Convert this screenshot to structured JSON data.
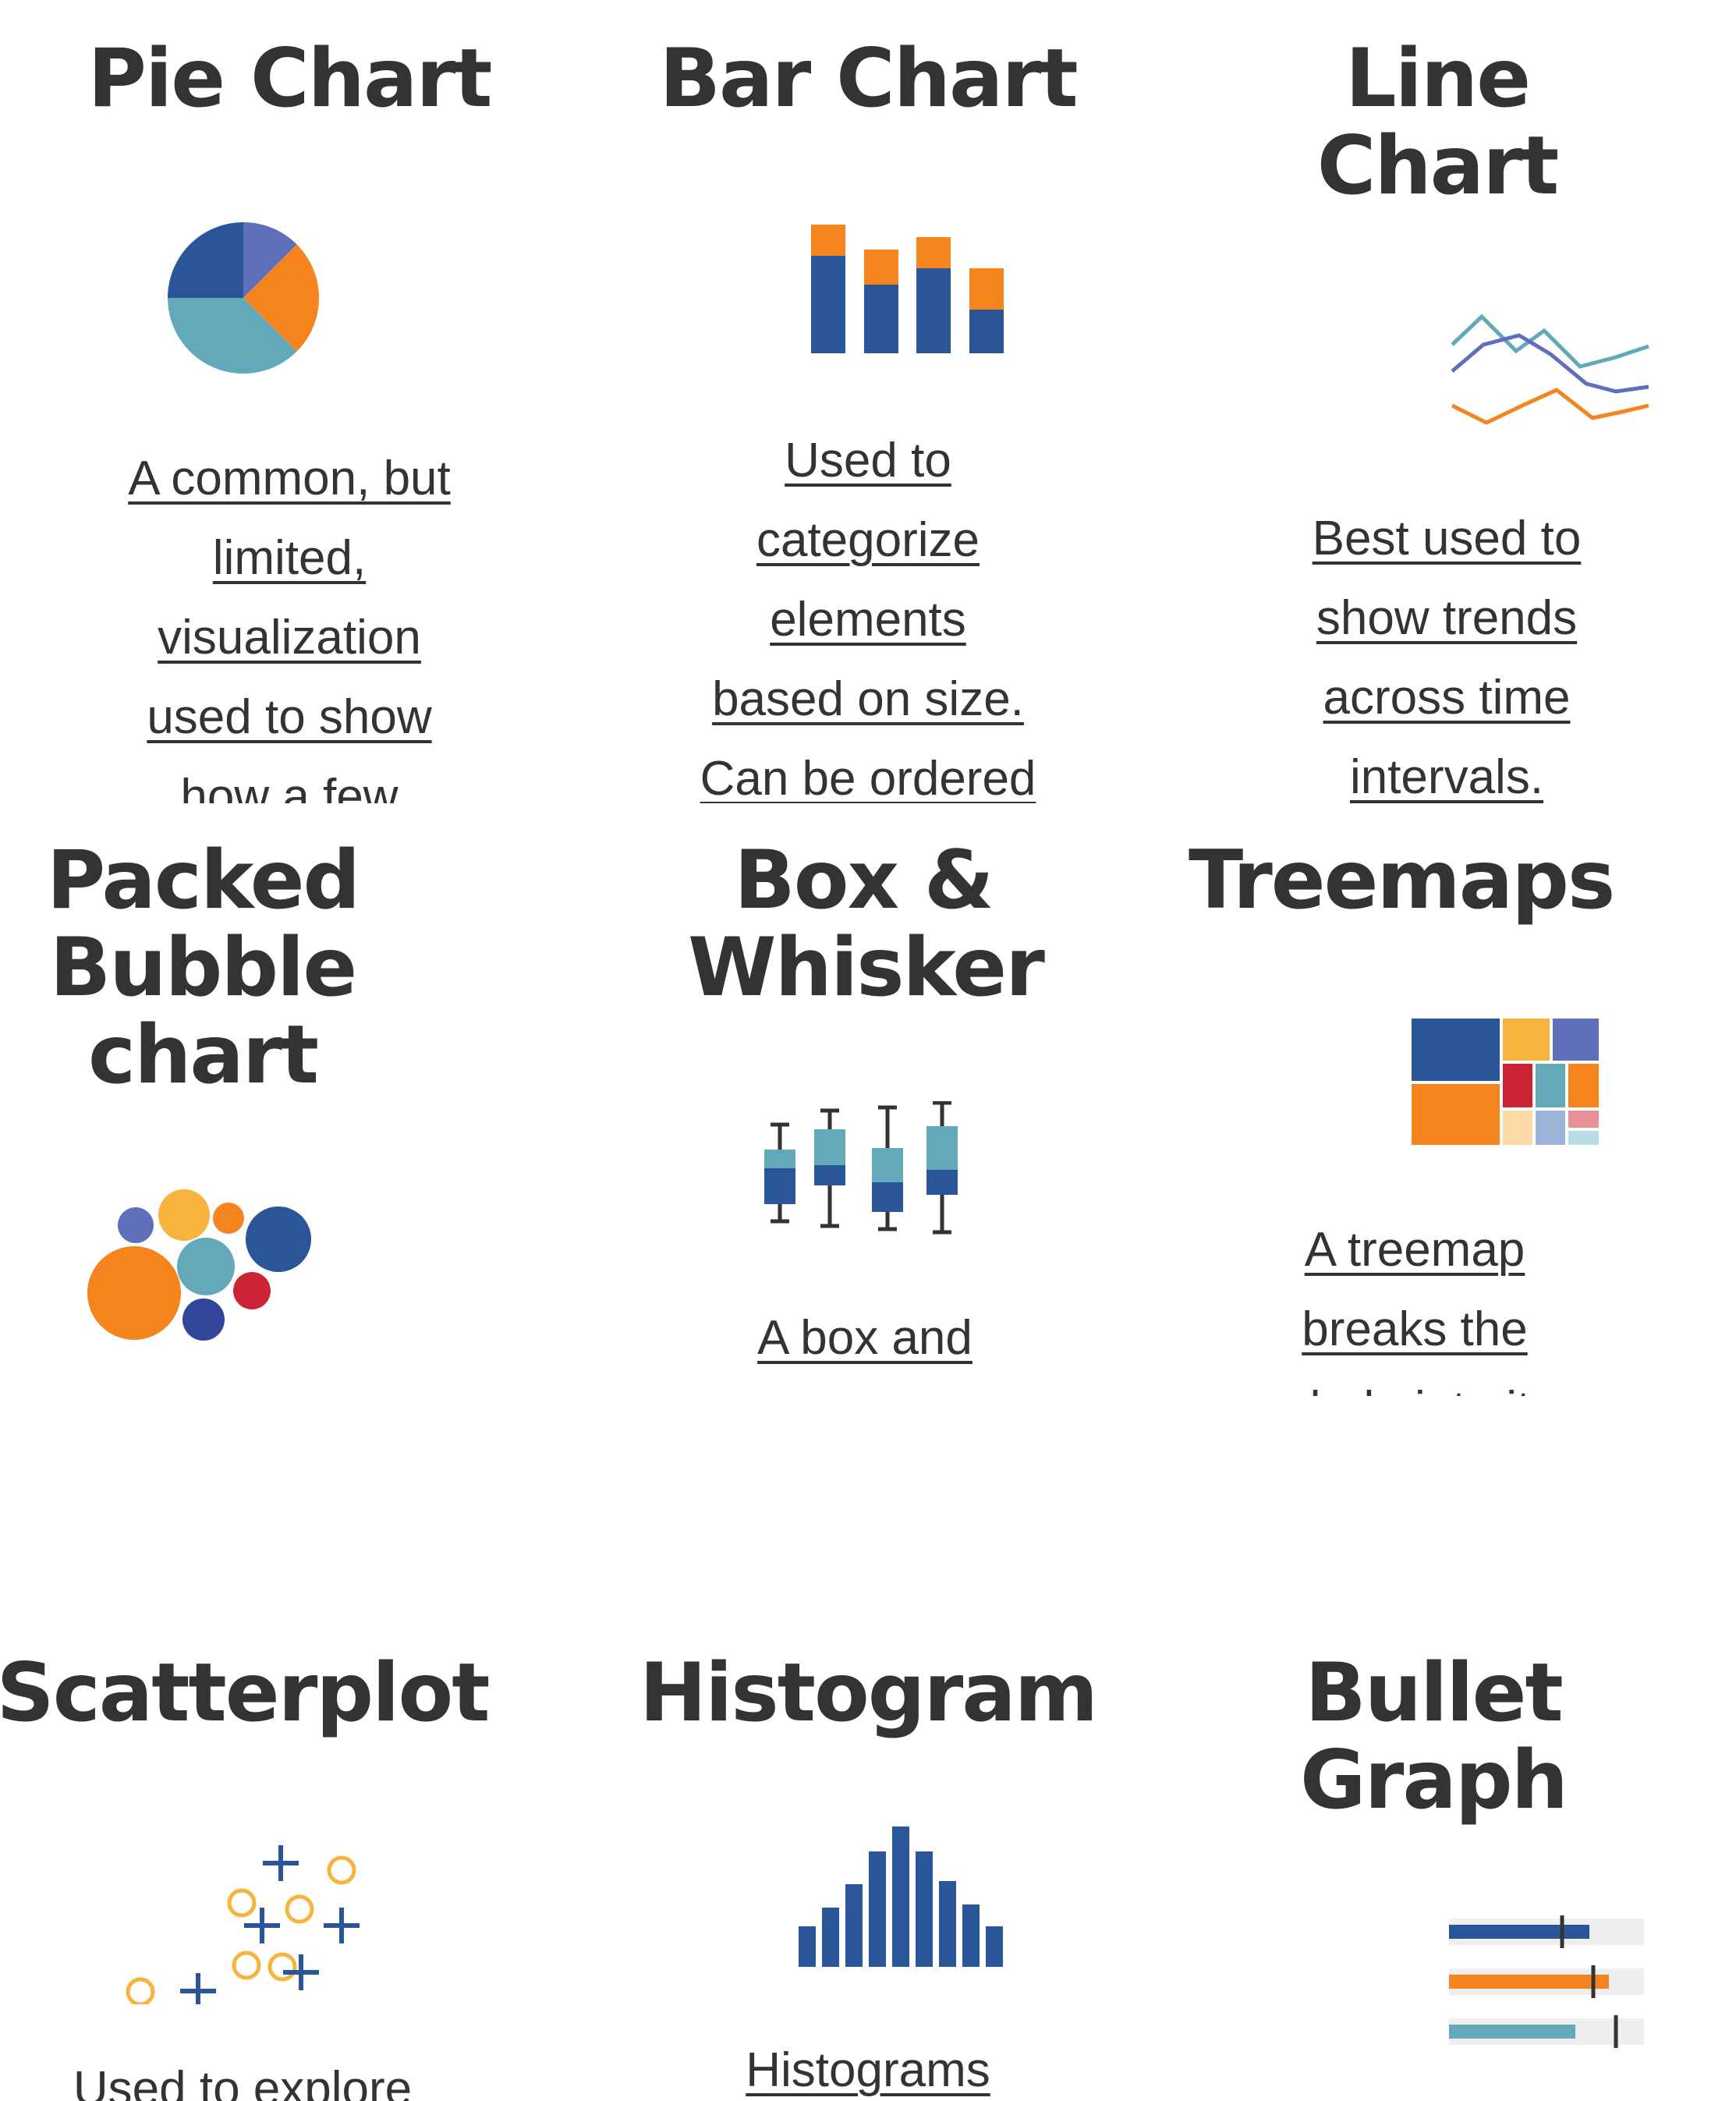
{
  "cards": [
    {
      "title": "Pie Chart",
      "icon": "pie-chart-icon",
      "desc_lines": [
        "A common, but",
        "limited,",
        "visualization",
        "used to show",
        "how a few"
      ]
    },
    {
      "title": "Bar Chart",
      "icon": "bar-chart-icon",
      "desc_lines": [
        "Used to",
        "categorize",
        "elements",
        "based on size.",
        "Can be ordered"
      ]
    },
    {
      "title": "Line Chart",
      "icon": "line-chart-icon",
      "desc_lines": [
        "Best used to",
        "show trends",
        "across time",
        "intervals."
      ]
    },
    {
      "title": "Packed Bubble chart",
      "icon": "packed-bubble-icon",
      "desc_lines": []
    },
    {
      "title": "Box & Whisker",
      "icon": "box-whisker-icon",
      "desc_lines": [
        "A box and"
      ]
    },
    {
      "title": "Treemaps",
      "icon": "treemap-icon",
      "desc_lines": [
        "A treemap",
        "breaks the",
        "whole into its"
      ]
    },
    {
      "title": "Scatterplot",
      "icon": "scatterplot-icon",
      "desc_lines": [
        "Used to explore"
      ]
    },
    {
      "title": "Histogram",
      "icon": "histogram-icon",
      "desc_lines": [
        "Histograms"
      ]
    },
    {
      "title": "Bullet Graph",
      "icon": "bullet-graph-icon",
      "desc_lines": []
    }
  ],
  "colors": {
    "blue": "#2a5598",
    "orange": "#f5841f",
    "teal": "#64a9ba",
    "periwinkle": "#5e6fbc",
    "yellow": "#f6b33d",
    "red": "#cc2336",
    "navy": "#33459a",
    "text": "#333333"
  }
}
